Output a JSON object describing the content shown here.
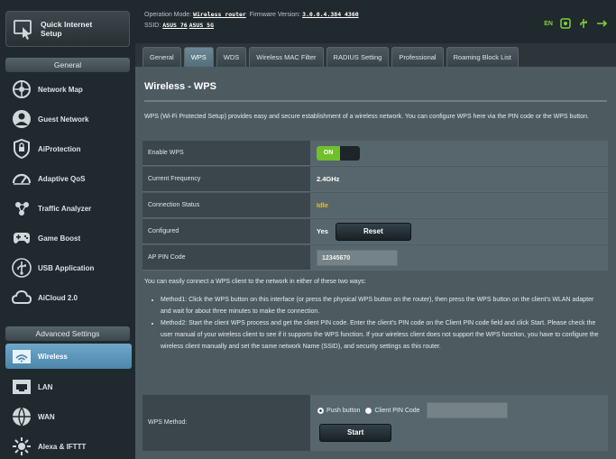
{
  "sidebar": {
    "quick_setup": "Quick Internet\nSetup",
    "general_title": "General",
    "general_items": [
      {
        "label": "Network Map",
        "icon": "network-map-icon"
      },
      {
        "label": "Guest Network",
        "icon": "guest-network-icon"
      },
      {
        "label": "AiProtection",
        "icon": "shield-icon"
      },
      {
        "label": "Adaptive QoS",
        "icon": "qos-gauge-icon"
      },
      {
        "label": "Traffic Analyzer",
        "icon": "traffic-analyzer-icon"
      },
      {
        "label": "Game Boost",
        "icon": "gamepad-icon"
      },
      {
        "label": "USB Application",
        "icon": "usb-icon"
      },
      {
        "label": "AiCloud 2.0",
        "icon": "cloud-icon"
      }
    ],
    "advanced_title": "Advanced Settings",
    "advanced_items": [
      {
        "label": "Wireless",
        "icon": "wireless-icon",
        "active": true
      },
      {
        "label": "LAN",
        "icon": "lan-icon"
      },
      {
        "label": "WAN",
        "icon": "wan-globe-icon"
      },
      {
        "label": "Alexa & IFTTT",
        "icon": "alexa-icon"
      }
    ]
  },
  "topbar": {
    "operation_mode_label": "Operation Mode:",
    "operation_mode": "Wireless router",
    "firmware_label": "Firmware Version:",
    "firmware": "3.0.0.4.384_4360",
    "ssid_label": "SSID:",
    "ssid_1": "ASUS_76",
    "ssid_2": "ASUS_5G",
    "language": "EN"
  },
  "tabs": [
    "General",
    "WPS",
    "WDS",
    "Wireless MAC Filter",
    "RADIUS Setting",
    "Professional",
    "Roaming Block List"
  ],
  "active_tab": "WPS",
  "main": {
    "title": "Wireless - WPS",
    "description": "WPS (Wi-Fi Protected Setup) provides easy and secure establishment of a wireless network. You can configure WPS here via the PIN code or the WPS button.",
    "rows": {
      "enable_wps": {
        "label": "Enable WPS",
        "value": "ON"
      },
      "current_frequency": {
        "label": "Current Frequency",
        "value": "2.4GHz"
      },
      "connection_status": {
        "label": "Connection Status",
        "value": "Idle"
      },
      "configured": {
        "label": "Configured",
        "value": "Yes",
        "button": "Reset"
      },
      "ap_pin": {
        "label": "AP PIN Code",
        "value": "12345670"
      }
    },
    "methods_intro": "You can easily connect a WPS client to the network in either of these two ways:",
    "method1": "Method1: Click the WPS button on this interface (or press the physical WPS button on the router), then press the WPS button on the client's WLAN adapter and wait for about three minutes to make the connection.",
    "method2": "Method2: Start the client WPS process and get the client PIN code. Enter the client's PIN code on the Client PIN code field and click Start. Please check the user manual of your wireless client to see if it supports the WPS function. If your wireless client does not support the WPS function, you have to configure the wireless client manually and set the same network Name (SSID), and security settings as this router.",
    "wps_method_label": "WPS Method:",
    "push_button_label": "Push button",
    "client_pin_label": "Client PIN Code",
    "start_button": "Start"
  }
}
